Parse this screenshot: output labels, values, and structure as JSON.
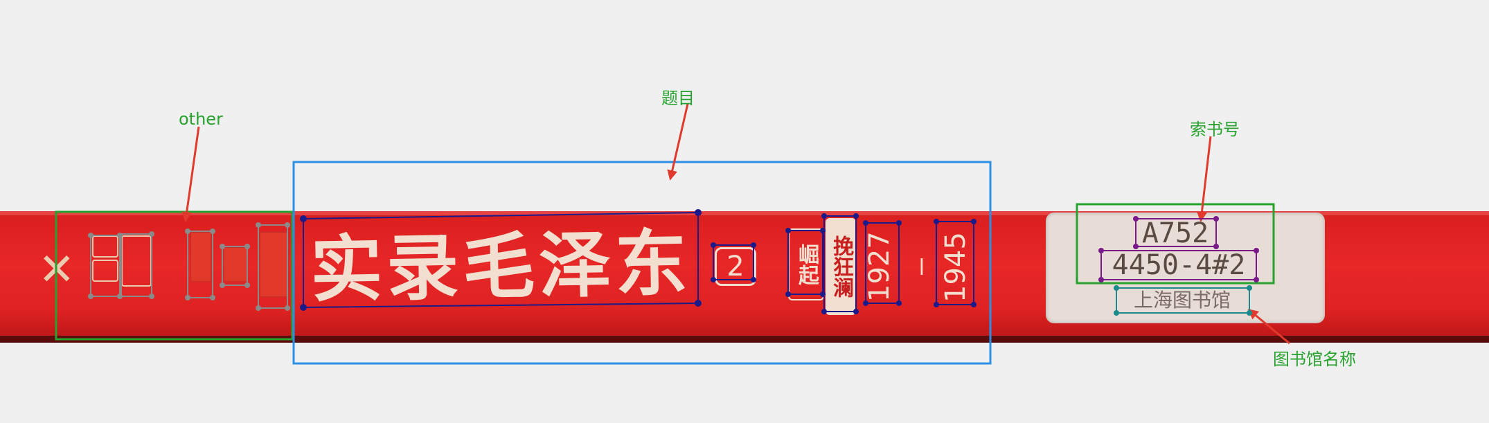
{
  "annotations": {
    "other": "other",
    "title": "题目",
    "call_number": "索书号",
    "library_name": "图书馆名称"
  },
  "spine": {
    "title": "实录毛泽东",
    "volume": "2",
    "subtitle_1": "崛起",
    "subtitle_2": "挽狂澜",
    "year_start": "1927",
    "separator": "—",
    "year_end": "1945",
    "call_number_line1": "A752",
    "call_number_line2": "4450-4#2",
    "library_name": "上海图书馆"
  },
  "colors": {
    "annotation_green": "#27a22e",
    "annotation_blue": "#2b8fe3",
    "annotation_red": "#e03a2e",
    "spine_red": "#e02424",
    "point_navy": "#1a1a8a",
    "point_gray": "#8a8a8a",
    "point_purple": "#7a1a8a",
    "point_teal": "#1a8a8a"
  }
}
